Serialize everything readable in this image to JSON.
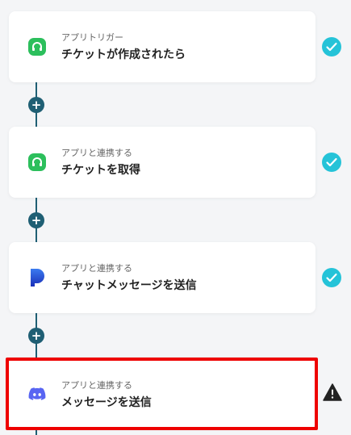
{
  "steps": [
    {
      "type_label": "アプリトリガー",
      "title": "チケットが作成されたら",
      "icon": "headset-icon",
      "status": "completed"
    },
    {
      "type_label": "アプリと連携する",
      "title": "チケットを取得",
      "icon": "headset-icon",
      "status": "completed"
    },
    {
      "type_label": "アプリと連携する",
      "title": "チャットメッセージを送信",
      "icon": "p-logo-icon",
      "status": "completed"
    },
    {
      "type_label": "アプリと連携する",
      "title": "メッセージを送信",
      "icon": "discord-icon",
      "status": "warning"
    }
  ],
  "add_button_label": "+",
  "colors": {
    "connector": "#1f5f74",
    "check": "#25c3d8",
    "highlight": "#ee0000",
    "headset_green": "#2cbf5c",
    "discord": "#5865f2"
  }
}
